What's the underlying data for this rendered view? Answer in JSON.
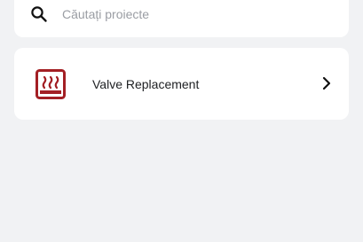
{
  "search": {
    "placeholder": "Căutați proiecte",
    "value": ""
  },
  "projects": [
    {
      "name": "Valve Replacement",
      "icon": "heating-icon",
      "icon_color": "#a31f24"
    }
  ],
  "colors": {
    "background": "#f1f2f4",
    "card": "#ffffff",
    "accent": "#a31f24"
  }
}
